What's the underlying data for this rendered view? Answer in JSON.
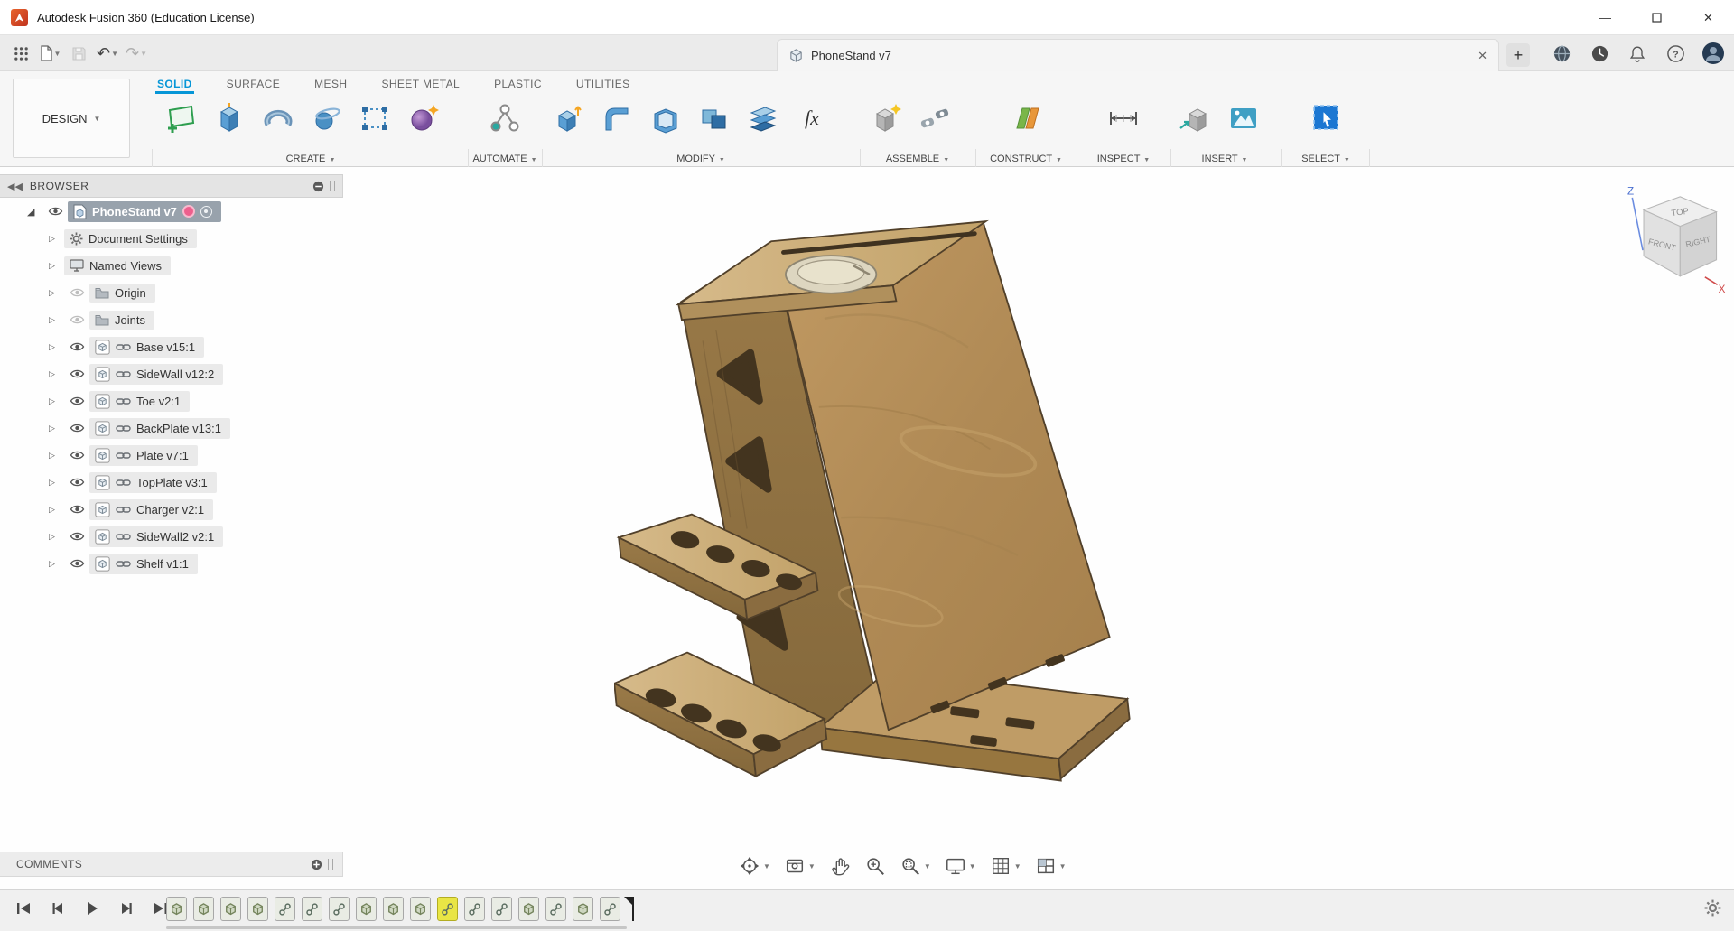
{
  "window": {
    "title": "Autodesk Fusion 360 (Education License)",
    "controls": [
      "minimize",
      "maximize",
      "close"
    ]
  },
  "qat": {
    "doc_tab_label": "PhoneStand v7",
    "left_icons": [
      "app-grid",
      "file",
      "save",
      "undo",
      "redo"
    ],
    "right_icons": [
      "close-tab",
      "new-tab",
      "globe",
      "clock",
      "bell",
      "help",
      "avatar"
    ]
  },
  "ribbon": {
    "design_label": "DESIGN",
    "tabs": [
      {
        "label": "SOLID",
        "active": true
      },
      {
        "label": "SURFACE",
        "active": false
      },
      {
        "label": "MESH",
        "active": false
      },
      {
        "label": "SHEET METAL",
        "active": false
      },
      {
        "label": "PLASTIC",
        "active": false
      },
      {
        "label": "UTILITIES",
        "active": false
      }
    ],
    "groups": [
      {
        "label": "CREATE",
        "icons": [
          "create-sketch",
          "extrude",
          "revolve",
          "sweep",
          "rectangular-pattern",
          "create-form"
        ]
      },
      {
        "label": "AUTOMATE",
        "icons": [
          "automate"
        ]
      },
      {
        "label": "MODIFY",
        "icons": [
          "press-pull",
          "fillet",
          "shell",
          "combine",
          "offset-face",
          "change-parameters-fx"
        ]
      },
      {
        "label": "ASSEMBLE",
        "icons": [
          "new-component",
          "joint"
        ]
      },
      {
        "label": "CONSTRUCT",
        "icons": [
          "construct-plane"
        ]
      },
      {
        "label": "INSPECT",
        "icons": [
          "measure"
        ]
      },
      {
        "label": "INSERT",
        "icons": [
          "insert-derive",
          "insert-canvas"
        ]
      },
      {
        "label": "SELECT",
        "icons": [
          "select"
        ]
      }
    ]
  },
  "browser": {
    "header": "BROWSER",
    "root_label": "PhoneStand v7",
    "items": [
      {
        "label": "Document Settings",
        "icon": "gear",
        "eye": "none",
        "linked": false
      },
      {
        "label": "Named Views",
        "icon": "views",
        "eye": "none",
        "linked": false
      },
      {
        "label": "Origin",
        "icon": "folder",
        "eye": "off",
        "linked": false
      },
      {
        "label": "Joints",
        "icon": "folder",
        "eye": "off",
        "linked": false
      },
      {
        "label": "Base v15:1",
        "icon": "component",
        "eye": "on",
        "linked": true
      },
      {
        "label": "SideWall v12:2",
        "icon": "component",
        "eye": "on",
        "linked": true
      },
      {
        "label": "Toe v2:1",
        "icon": "component",
        "eye": "on",
        "linked": true
      },
      {
        "label": "BackPlate v13:1",
        "icon": "component",
        "eye": "on",
        "linked": true
      },
      {
        "label": "Plate v7:1",
        "icon": "component",
        "eye": "on",
        "linked": true
      },
      {
        "label": "TopPlate v3:1",
        "icon": "component",
        "eye": "on",
        "linked": true
      },
      {
        "label": "Charger v2:1",
        "icon": "component",
        "eye": "on",
        "linked": true
      },
      {
        "label": "SideWall2 v2:1",
        "icon": "component",
        "eye": "on",
        "linked": true
      },
      {
        "label": "Shelf v1:1",
        "icon": "component",
        "eye": "on",
        "linked": true
      }
    ]
  },
  "comments": {
    "label": "COMMENTS"
  },
  "viewcube": {
    "top": "TOP",
    "front": "FRONT",
    "right": "RIGHT",
    "axis_z": "Z",
    "axis_x": "X"
  },
  "navbar": {
    "items": [
      "orbit",
      "look-at",
      "pan",
      "zoom",
      "fit",
      "display-settings",
      "grid-and-snaps",
      "viewports"
    ]
  },
  "timeline": {
    "playback": [
      "skip-to-start",
      "step-back",
      "play",
      "step-forward",
      "skip-to-end"
    ],
    "highlight_index": 10,
    "features": [
      {
        "type": "component"
      },
      {
        "type": "component"
      },
      {
        "type": "component"
      },
      {
        "type": "component"
      },
      {
        "type": "joint"
      },
      {
        "type": "joint"
      },
      {
        "type": "joint"
      },
      {
        "type": "component"
      },
      {
        "type": "component"
      },
      {
        "type": "component"
      },
      {
        "type": "joint"
      },
      {
        "type": "joint"
      },
      {
        "type": "joint"
      },
      {
        "type": "component"
      },
      {
        "type": "joint"
      },
      {
        "type": "component"
      },
      {
        "type": "joint"
      }
    ]
  },
  "colors": {
    "accent": "#0696d7",
    "selected_row": "#98a2ac",
    "timeline_highlight": "#e9e545",
    "wood_light": "#ccb07e",
    "wood_mid": "#b6925e",
    "wood_dark": "#8f7043"
  }
}
